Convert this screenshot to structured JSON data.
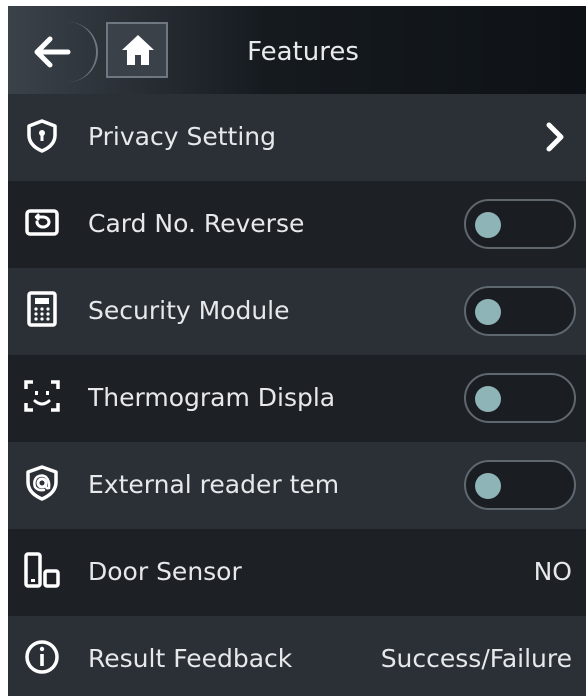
{
  "header": {
    "title": "Features",
    "back_icon": "arrow-left-icon",
    "home_icon": "home-icon"
  },
  "items": [
    {
      "label": "Privacy Setting",
      "icon": "shield-icon",
      "control": "chevron"
    },
    {
      "label": "Card No. Reverse",
      "icon": "card-icon",
      "control": "toggle",
      "enabled": false
    },
    {
      "label": "Security Module",
      "icon": "keypad-icon",
      "control": "toggle",
      "enabled": false
    },
    {
      "label": "Thermogram Displa",
      "icon": "face-scan-icon",
      "control": "toggle",
      "enabled": false
    },
    {
      "label": "External reader tem",
      "icon": "shield-at-icon",
      "control": "toggle",
      "enabled": false
    },
    {
      "label": "Door Sensor",
      "icon": "door-sensor-icon",
      "control": "value",
      "value": "NO"
    },
    {
      "label": "Result Feedback",
      "icon": "info-icon",
      "control": "value",
      "value": "Success/Failure"
    }
  ],
  "colors": {
    "toggle_knob": "#8fb4b8",
    "row_light": "#2b3036",
    "row_dark": "#1d2126"
  }
}
